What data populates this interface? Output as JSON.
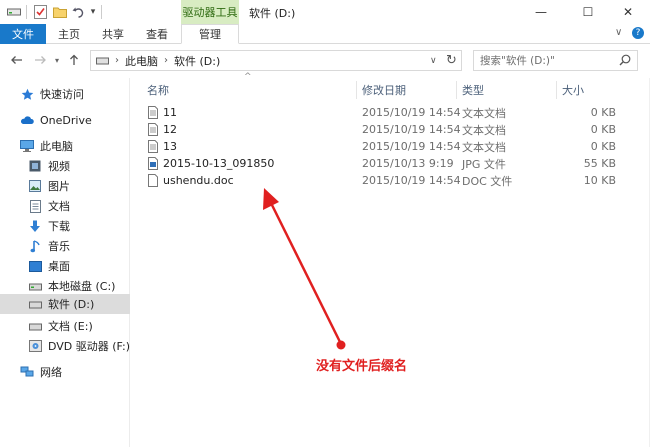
{
  "title_bar": {
    "context_tab": "驱动器工具",
    "window_title": "软件 (D:)",
    "minimize": "—",
    "maximize": "☐",
    "close": "✕"
  },
  "ribbon": {
    "tabs": [
      "文件",
      "主页",
      "共享",
      "查看",
      "管理"
    ],
    "expand": "∨",
    "help": "?"
  },
  "address_bar": {
    "path": [
      "此电脑",
      "软件 (D:)"
    ],
    "search_placeholder": "搜索\"软件 (D:)\""
  },
  "sidebar": {
    "items": [
      {
        "label": "快速访问",
        "icon": "star-icon"
      },
      {
        "label": "OneDrive",
        "icon": "cloud-icon"
      },
      {
        "label": "此电脑",
        "icon": "computer-icon"
      },
      {
        "label": "视频",
        "icon": "video-icon"
      },
      {
        "label": "图片",
        "icon": "pictures-icon"
      },
      {
        "label": "文档",
        "icon": "documents-icon"
      },
      {
        "label": "下载",
        "icon": "download-icon"
      },
      {
        "label": "音乐",
        "icon": "music-icon"
      },
      {
        "label": "桌面",
        "icon": "desktop-icon"
      },
      {
        "label": "本地磁盘 (C:)",
        "icon": "drive-icon"
      },
      {
        "label": "软件 (D:)",
        "icon": "drive-icon"
      },
      {
        "label": "文档 (E:)",
        "icon": "drive-icon"
      },
      {
        "label": "DVD 驱动器 (F:) JM",
        "icon": "dvd-icon"
      },
      {
        "label": "网络",
        "icon": "network-icon"
      }
    ],
    "selected_index": 10
  },
  "file_list": {
    "columns": [
      "名称",
      "修改日期",
      "类型",
      "大小"
    ],
    "rows": [
      {
        "name": "11",
        "date": "2015/10/19 14:54",
        "type": "文本文档",
        "size": "0 KB",
        "icon": "text-file-icon"
      },
      {
        "name": "12",
        "date": "2015/10/19 14:54",
        "type": "文本文档",
        "size": "0 KB",
        "icon": "text-file-icon"
      },
      {
        "name": "13",
        "date": "2015/10/19 14:54",
        "type": "文本文档",
        "size": "0 KB",
        "icon": "text-file-icon"
      },
      {
        "name": "2015-10-13_091850",
        "date": "2015/10/13 9:19",
        "type": "JPG 文件",
        "size": "55 KB",
        "icon": "image-file-icon"
      },
      {
        "name": "ushendu.doc",
        "date": "2015/10/19 14:54",
        "type": "DOC 文件",
        "size": "10 KB",
        "icon": "doc-file-icon"
      }
    ]
  },
  "annotation": {
    "text": "没有文件后缀名",
    "color": "#e02020"
  },
  "colors": {
    "file_tab": "#1979ca",
    "context_tab": "#d8ecc2",
    "selection": "#dcdcdc"
  }
}
